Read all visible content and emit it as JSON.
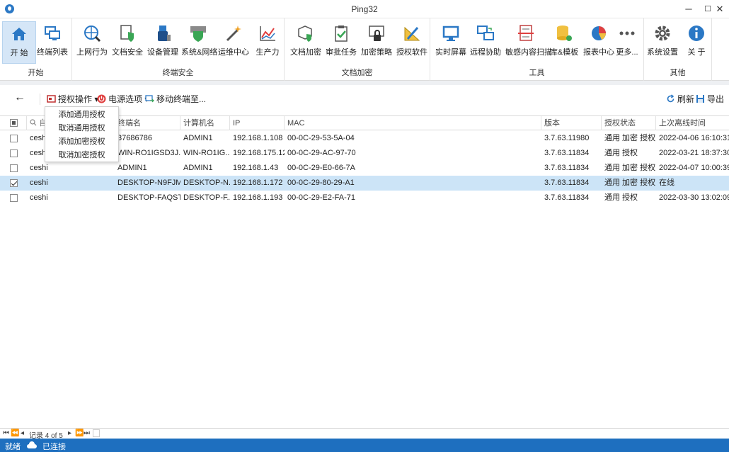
{
  "window": {
    "title": "Ping32",
    "minimize": "─",
    "maximize": "☐",
    "close": "✕"
  },
  "ribbon": {
    "groups": [
      {
        "label": "开始",
        "buttons": [
          {
            "label": "开 始",
            "icon": "home-icon"
          },
          {
            "label": "终端列表",
            "icon": "monitors-icon"
          }
        ]
      },
      {
        "label": "终端安全",
        "buttons": [
          {
            "label": "上网行为",
            "icon": "globe-search-icon"
          },
          {
            "label": "文档安全",
            "icon": "document-shield-icon"
          },
          {
            "label": "设备管理",
            "icon": "usb-device-icon"
          },
          {
            "label": "系统&网络",
            "icon": "firewall-shield-icon"
          },
          {
            "label": "运维中心",
            "icon": "magic-wand-icon"
          },
          {
            "label": "生产力",
            "icon": "line-chart-icon"
          }
        ]
      },
      {
        "label": "文档加密",
        "buttons": [
          {
            "label": "文档加密",
            "icon": "cube-shield-icon"
          },
          {
            "label": "审批任务",
            "icon": "clipboard-check-icon"
          },
          {
            "label": "加密策略",
            "icon": "lock-window-icon"
          },
          {
            "label": "授权软件",
            "icon": "pencil-ruler-icon"
          }
        ]
      },
      {
        "label": "工具",
        "buttons": [
          {
            "label": "实时屏幕",
            "icon": "screen-icon"
          },
          {
            "label": "远程协助",
            "icon": "remote-desktop-icon"
          },
          {
            "label": "敏感内容扫描",
            "icon": "document-scan-icon"
          },
          {
            "label": "库&模板",
            "icon": "database-gear-icon"
          },
          {
            "label": "报表中心",
            "icon": "pie-chart-icon"
          },
          {
            "label": "更多...",
            "icon": "more-dots-icon"
          }
        ]
      },
      {
        "label": "其他",
        "buttons": [
          {
            "label": "系统设置",
            "icon": "gear-icon"
          },
          {
            "label": "关 于",
            "icon": "info-icon"
          }
        ]
      }
    ]
  },
  "toolbar": {
    "back": "←",
    "auth_ops": "授权操作 ▾",
    "power": "电源选项 ▾",
    "move": "移动终端至...",
    "refresh": "刷新",
    "export": "导出"
  },
  "auth_menu": [
    "添加通用授权",
    "取消通用授权",
    "添加加密授权",
    "取消加密授权"
  ],
  "table": {
    "search_placeholder": "自",
    "columns": [
      "终端名",
      "计算机名",
      "IP",
      "MAC",
      "版本",
      "授权状态",
      "上次离线时间"
    ],
    "rows": [
      {
        "checked": false,
        "group": "ceshi",
        "name": "37686786",
        "computer": "ADMIN1",
        "ip": "192.168.1.108",
        "mac": "00-0C-29-53-5A-04",
        "version": "3.7.63.11980",
        "auth": "通用 加密 授权",
        "offline": "2022-04-06 16:10:31"
      },
      {
        "checked": false,
        "group": "ceshi",
        "name": "WIN-RO1IGSD3J...",
        "computer": "WIN-RO1IG...",
        "ip": "192.168.175.128",
        "mac": "00-0C-29-AC-97-70",
        "version": "3.7.63.11834",
        "auth": "通用 授权",
        "offline": "2022-03-21 18:37:30"
      },
      {
        "checked": false,
        "group": "ceshi",
        "name": "ADMIN1",
        "computer": "ADMIN1",
        "ip": "192.168.1.43",
        "mac": "00-0C-29-E0-66-7A",
        "version": "3.7.63.11834",
        "auth": "通用 加密 授权",
        "offline": "2022-04-07 10:00:39"
      },
      {
        "checked": true,
        "group": "ceshi",
        "name": "DESKTOP-N9FJMLI",
        "computer": "DESKTOP-N...",
        "ip": "192.168.1.172",
        "mac": "00-0C-29-80-29-A1",
        "version": "3.7.63.11834",
        "auth": "通用 加密 授权",
        "offline": "在线"
      },
      {
        "checked": false,
        "group": "ceshi",
        "name": "DESKTOP-FAQST...",
        "computer": "DESKTOP-F...",
        "ip": "192.168.1.193",
        "mac": "00-0C-29-E2-FA-71",
        "version": "3.7.63.11834",
        "auth": "通用 授权",
        "offline": "2022-03-30 13:02:09"
      }
    ]
  },
  "pager": {
    "first": "⏮",
    "prev_page": "⏪",
    "prev": "◂",
    "record": "记录 4 of 5",
    "next": "▸",
    "next_page": "⏩",
    "last": "⏭"
  },
  "status": {
    "ready": "就绪",
    "connection": "已连接"
  },
  "colors": {
    "accent": "#1e6fbf",
    "selected_row": "#cce4f7",
    "active_button": "#d5e6f7"
  }
}
